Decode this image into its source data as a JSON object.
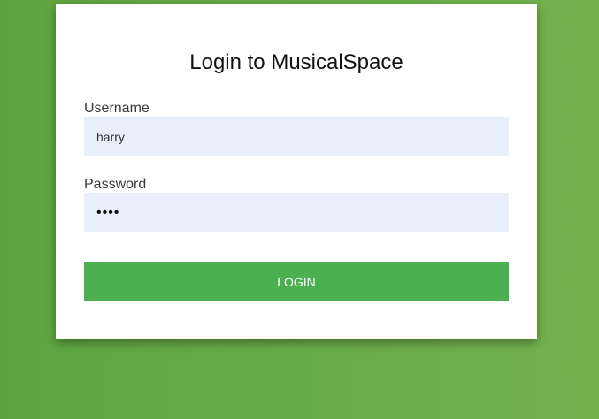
{
  "login": {
    "title": "Login to MusicalSpace",
    "username": {
      "label": "Username",
      "value": "harry"
    },
    "password": {
      "label": "Password",
      "value": "••••"
    },
    "button_label": "LOGIN"
  },
  "colors": {
    "background": "#67ab47",
    "card": "#ffffff",
    "input_background": "#e8effb",
    "button": "#4caf50",
    "button_text": "#ffffff"
  }
}
